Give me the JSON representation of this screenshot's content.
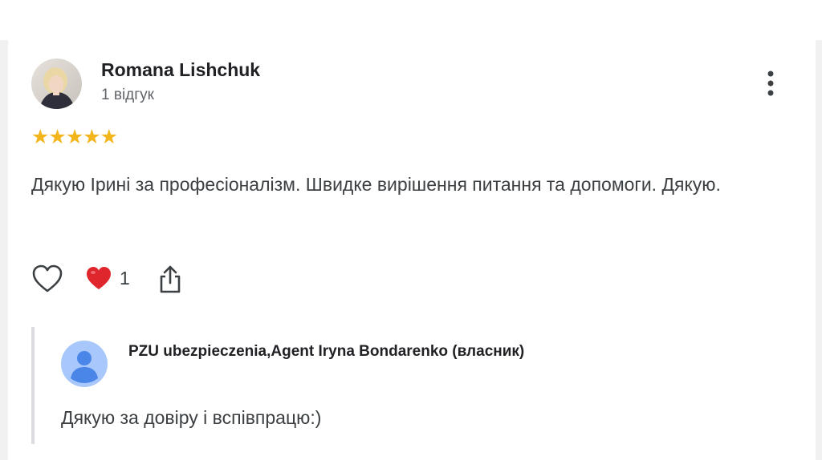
{
  "review": {
    "reviewer_name": "Romana Lishchuk",
    "review_count": "1 відгук",
    "rating": 5,
    "stars": "★★★★★",
    "text": "Дякую Ірині за професіоналізм. Швидке вирішення питання та допомоги. Дякую.",
    "reaction_count": "1"
  },
  "reply": {
    "owner_name": "PZU ubezpieczenia,Agent Iryna Bondarenko (власник)",
    "text": "Дякую за довіру і вспівпрацю:)"
  },
  "colors": {
    "star": "#f3b51c",
    "heart": "#e0262d",
    "owner_avatar_bg": "#a8c7fa",
    "owner_avatar_fg": "#4a86e8"
  },
  "icons": {
    "like": "heart-outline-icon",
    "reaction": "red-heart-icon",
    "share": "share-icon",
    "menu": "more-vertical-icon"
  }
}
